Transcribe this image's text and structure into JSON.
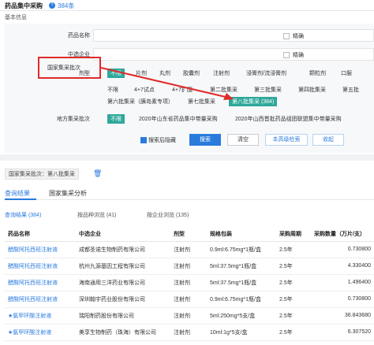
{
  "header": {
    "title": "药品集中采购",
    "help_icon": "question-icon",
    "count": "384条"
  },
  "section_label": "基本信息",
  "filters": {
    "drug_name": {
      "label": "药品名称",
      "exact_label": "精确"
    },
    "company": {
      "label": "中选企业",
      "exact_label": "精确"
    },
    "dosage": {
      "label": "剂型",
      "options": [
        "不限",
        "片剂",
        "丸剂",
        "胶囊剂",
        "注射剂",
        "浸膏剂/流浸膏剂",
        "颗粒剂",
        "口服"
      ]
    },
    "batch": {
      "label": "国家集采批次",
      "options_row1": [
        "不限",
        "4+7试点",
        "4+7扩围",
        "第二批集采",
        "第三批集采",
        "第四批集采",
        "第五批"
      ],
      "options_row2": [
        "第六批集采（胰岛素专项）",
        "第七批集采",
        "第八批集采 (384)"
      ]
    },
    "local": {
      "label": "地方集采批次",
      "options": [
        "不限",
        "2020年山东省药品集中带量采购",
        "2020年山西晋批药品组团联盟集中带量采购"
      ]
    }
  },
  "actions": {
    "hide_after_search": "搜索后隐藏",
    "search": "搜索",
    "clear": "清空",
    "advanced": "本高级检索",
    "collapse": "收起"
  },
  "selected_tag": "国家集采批次：第八批集采",
  "tabs": [
    "查询结果",
    "国家集采分析"
  ],
  "subtabs": [
    "查询结果 (384)",
    "按品种浏览 (41)",
    "按企业浏览 (135)"
  ],
  "table": {
    "headers": [
      "药品名称",
      "中选企业",
      "剂型",
      "规格包装",
      "采购周期",
      "采购数量（万片/支）"
    ],
    "rows": [
      {
        "name": "醋酸阿托西班注射液",
        "company": "成都圣诺生物制药有限公司",
        "dosage": "注射剂",
        "spec": "0.9ml:6.75mg*1瓶/盒",
        "period": "2.5年",
        "qty": "0.730800"
      },
      {
        "name": "醋酸阿托西班注射液",
        "company": "杭州九源基因工程有限公司",
        "dosage": "注射剂",
        "spec": "5ml:37.5mg*1瓶/盒",
        "period": "2.5年",
        "qty": "4.330400"
      },
      {
        "name": "醋酸阿托西班注射液",
        "company": "海南通用三洋药业有限公司",
        "dosage": "注射剂",
        "spec": "5ml:37.5mg*1瓶/盒",
        "period": "2.5年",
        "qty": "1.496400"
      },
      {
        "name": "醋酸阿托西班注射液",
        "company": "深圳翰宇药业股份有限公司",
        "dosage": "注射剂",
        "spec": "0.9ml:6.75mg*1瓶/盒",
        "period": "2.5年",
        "qty": "0.730800"
      },
      {
        "name": "★氨甲环酸注射液",
        "company": "瑞阳制药股份有限公司",
        "dosage": "注射剂",
        "spec": "5ml:250mg*5支/盒",
        "period": "2.5年",
        "qty": "36.843680"
      },
      {
        "name": "★氨甲环酸注射液",
        "company": "美享生物制药（珠海）有限公司",
        "dosage": "注射剂",
        "spec": "10ml:1g*5支/盒",
        "period": "2.5年",
        "qty": "6.307520"
      }
    ]
  },
  "colors": {
    "accent": "#2a7bdc",
    "active_chip": "#2fa89a",
    "highlight": "#e02a2a"
  }
}
